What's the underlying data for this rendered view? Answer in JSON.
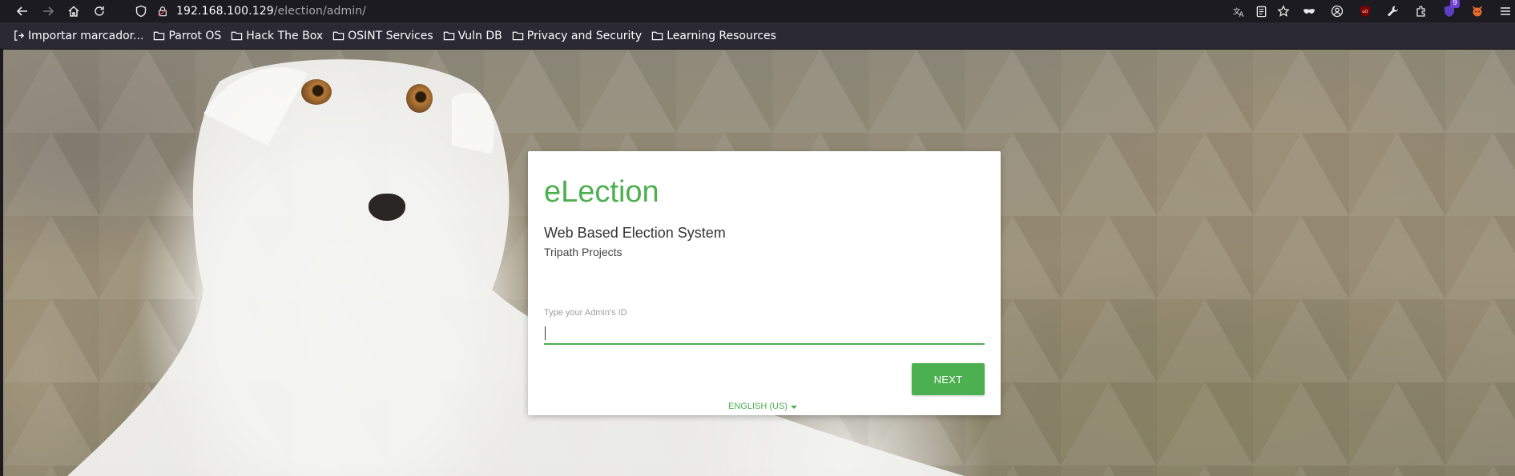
{
  "browser": {
    "url_host": "192.168.100.129",
    "url_path": "/election/admin/",
    "extension_badge": "9"
  },
  "bookmarks": [
    {
      "label": "Importar marcador...",
      "icon": "import-icon"
    },
    {
      "label": "Parrot OS",
      "icon": "folder-icon"
    },
    {
      "label": "Hack The Box",
      "icon": "folder-icon"
    },
    {
      "label": "OSINT Services",
      "icon": "folder-icon"
    },
    {
      "label": "Vuln DB",
      "icon": "folder-icon"
    },
    {
      "label": "Privacy and Security",
      "icon": "folder-icon"
    },
    {
      "label": "Learning Resources",
      "icon": "folder-icon"
    }
  ],
  "card": {
    "title": "eLection",
    "subtitle": "Web Based Election System",
    "org": "Tripath Projects",
    "field_label": "Type your Admin's ID",
    "field_value": "",
    "next_label": "NEXT"
  },
  "footer": {
    "language": "ENGLISH (US)"
  },
  "colors": {
    "accent": "#4caf50",
    "chrome_bg": "#1c1b22",
    "bookmarks_bg": "#2b2a33"
  }
}
